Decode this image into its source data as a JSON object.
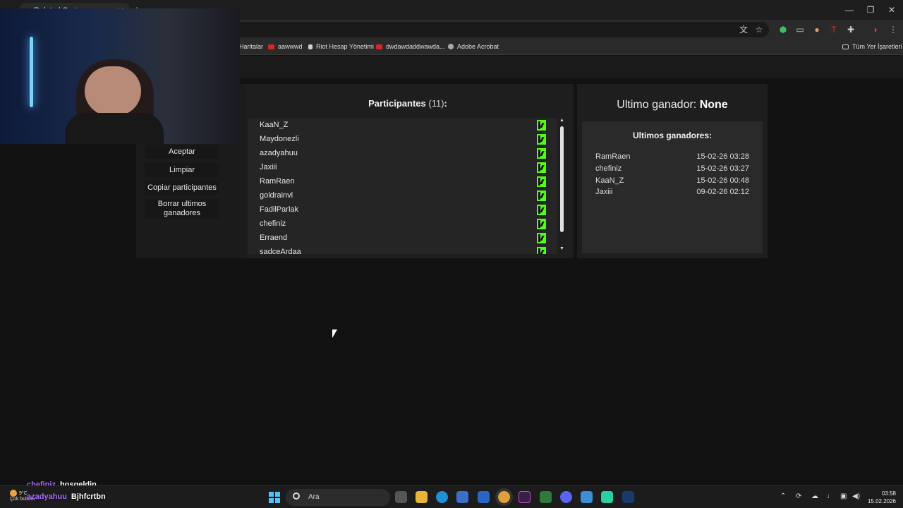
{
  "browser": {
    "tab_title": "Ruleta | Sorteos",
    "bookmarks": [
      "Haritalar",
      "aawwwd",
      "Riot Hesap Yönetimi",
      "dwdawdaddwawda...",
      "Adobe Acrobat"
    ],
    "all_bookmarks": "Tüm Yer İşaretleri"
  },
  "controls": {
    "accept": "Aceptar",
    "clear": "Limpiar",
    "copy": "Copiar participantes",
    "delete_last": "Borrar ultimos ganadores"
  },
  "participants": {
    "title": "Participantes",
    "count": "(11)",
    "colon": ":",
    "names": [
      "KaaN_Z",
      "Maydonezli",
      "azadyahuu",
      "Jaxiii",
      "RamRaen",
      "goldrainvl",
      "FadilParlak",
      "chefiniz",
      "Erraend",
      "sadceArdaa"
    ]
  },
  "winner": {
    "label": "Ultimo ganador:",
    "value": "None",
    "history_title": "Ultimos ganadores:",
    "history": [
      {
        "name": "RamRaen",
        "date": "15-02-26 03:28"
      },
      {
        "name": "chefiniz",
        "date": "15-02-26 03:27"
      },
      {
        "name": "KaaN_Z",
        "date": "15-02-26 00:48"
      },
      {
        "name": "Jaxiii",
        "date": "09-02-26 02:12"
      }
    ]
  },
  "chat": [
    {
      "user": "chefiniz",
      "message": "hosgeldin"
    },
    {
      "user": "azadyahuu",
      "message": "Bjhfcrtbn"
    }
  ],
  "taskbar": {
    "weather_temp": "9°C",
    "weather_desc": "Çok bulutlu",
    "search_placeholder": "Ara",
    "time": "03:58",
    "date": "15.02.2026"
  },
  "colors": {
    "kick_green": "#53fc18",
    "chat_user": "#a970ff",
    "windows_blue": "#4cc2ff"
  }
}
